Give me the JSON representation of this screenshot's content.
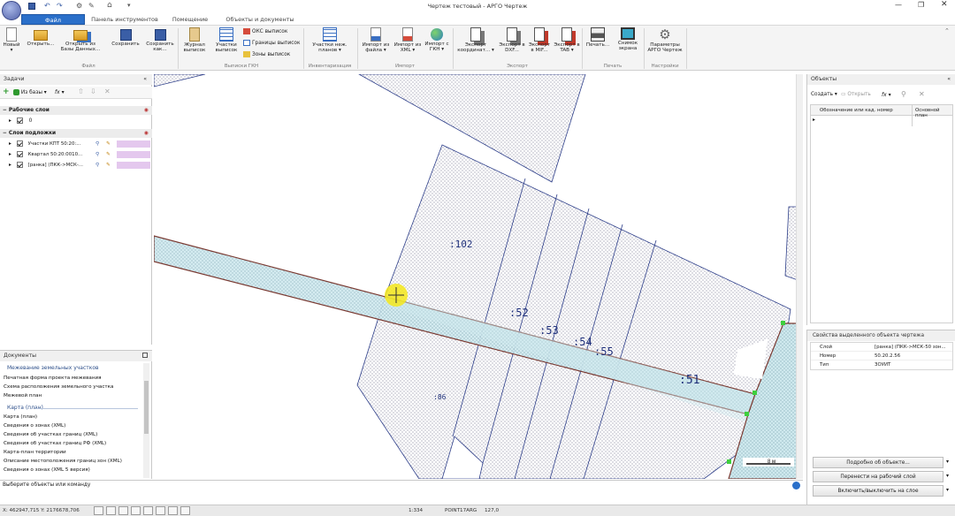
{
  "window": {
    "title": "Чертеж тестовый - АРГО Чертеж"
  },
  "tabs": [
    "Файл",
    "Панель инструментов",
    "Помещение",
    "Объекты и документы"
  ],
  "ribbon": {
    "new": "Новый",
    "open": "Открыть...",
    "open_db": "Открыть из Базы Данных...",
    "save": "Сохранить",
    "save_as": "Сохранить как...",
    "log": "Журнал выписок",
    "plots_ext": "Участки выписок",
    "oks_ext": "ОКС выписок",
    "bounds_ext": "Границы выписок",
    "zones_ext": "Зоны выписок",
    "inv_plots": "Участки неж. планов",
    "import_file": "Импорт из файла",
    "import_xml": "Импорт из XML",
    "import_gkn": "Импорт с ГКН",
    "exp_coords": "Экспорт координат...",
    "exp_dxf": "Экспорт в DXF...",
    "exp_mif": "Экспорт в MIF...",
    "exp_tab": "Экспорт в TAB",
    "print": "Печать...",
    "screenshot": "Снимок экрана",
    "params": "Параметры АРГО Чертеж",
    "groups": {
      "file": "Файл",
      "gkn": "Выписки ГКН",
      "inv": "Инвентаризация",
      "import": "Импорт",
      "export": "Экспорт",
      "print": "Печать",
      "settings": "Настройки"
    }
  },
  "tasks": {
    "title": "Задачи",
    "from_db": "Из базы",
    "fx": "fx",
    "work_layer": "Рабочие слои",
    "work_item": "0",
    "base_layer": "Слои подложки",
    "base_items": [
      "Участки КПТ 50:20:...",
      "Квартал 50:20:0010...",
      "[ранка] (ПКК->МСК-..."
    ]
  },
  "docs": {
    "title": "Документы",
    "sec1": "Межевание земельных участков",
    "items1": [
      "Печатная форма проекта межевания",
      "Схема расположения земельного участка",
      "Межевой план"
    ],
    "sec2": "Карта (план)",
    "items2": [
      "Карта (план)",
      "Сведения о зонах (XML)",
      "Сведения об участках границ (XML)",
      "Сведения об участках границ РФ (XML)",
      "Карта-план территории",
      "Описание местоположения границ зон (XML)",
      "Сведения о зонах (XML 5 версия)"
    ]
  },
  "map": {
    "labels": [
      ":102",
      ":52",
      ":53",
      ":54",
      ":55",
      ":51",
      ":86"
    ],
    "scale": "8 м"
  },
  "objects": {
    "title": "Объекты",
    "create": "Создать",
    "open": "Открыть",
    "fx": "fx",
    "col1": "Обозначение или кад. номер",
    "col2": "Основной план"
  },
  "props": {
    "title": "Свойства выделенного объекта чертежа",
    "rows": [
      {
        "k": "Слой",
        "v": "[ранка] (ПКК->МСК-50 зон..."
      },
      {
        "k": "Номер",
        "v": "50.20.2.56"
      },
      {
        "k": "Тип",
        "v": "ЗОУИТ"
      }
    ],
    "btn_detail": "Подробно об объекте...",
    "btn_move": "Перенести на рабочий слой",
    "btn_toggle": "Включить/выключить на слое"
  },
  "cmd": {
    "prompt": "Выберите объекты или команду"
  },
  "status": {
    "coords": "X: 462947,715 Y: 2176678,706",
    "scale": "1:334",
    "snap": "POINT17ARG",
    "value": "127,0"
  },
  "colors": {
    "accent": "#2a6fc9",
    "zone_fill": "#cfe9ee",
    "zone_border": "#7a3a32",
    "layer_swatch": "#e4c8ee",
    "vertex": "#3ecf3e"
  }
}
